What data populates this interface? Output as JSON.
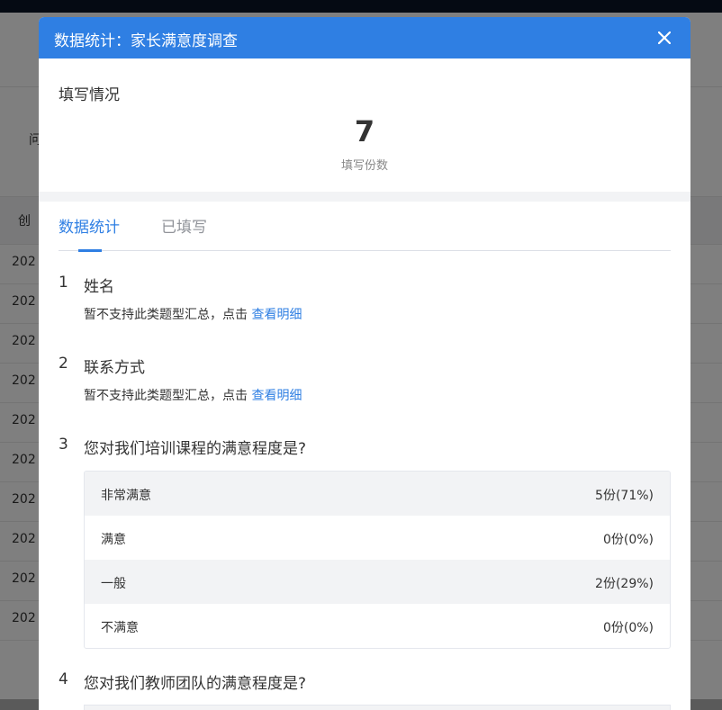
{
  "modal": {
    "title": "数据统计：家长满意度调查",
    "fill_heading": "填写情况",
    "fill_count": "7",
    "fill_count_label": "填写份数",
    "tabs": [
      "数据统计",
      "已填写"
    ]
  },
  "background": {
    "label_a": "问",
    "label_b": "创",
    "row_prefix": "202"
  },
  "questions": [
    {
      "num": "1",
      "text": "姓名",
      "note": "暂不支持此类题型汇总，点击",
      "link": "查看明细"
    },
    {
      "num": "2",
      "text": "联系方式",
      "note": "暂不支持此类题型汇总，点击",
      "link": "查看明细"
    },
    {
      "num": "3",
      "text": "您对我们培训课程的满意程度是?",
      "options": [
        {
          "label": "非常满意",
          "value": "5份(71%)"
        },
        {
          "label": "满意",
          "value": "0份(0%)"
        },
        {
          "label": "一般",
          "value": "2份(29%)"
        },
        {
          "label": "不满意",
          "value": "0份(0%)"
        }
      ]
    },
    {
      "num": "4",
      "text": "您对我们教师团队的满意程度是?"
    }
  ],
  "colors": {
    "accent": "#2f7fe3",
    "header_bg": "#2f7fe3",
    "overlay": "rgba(0,0,0,0.5)"
  }
}
